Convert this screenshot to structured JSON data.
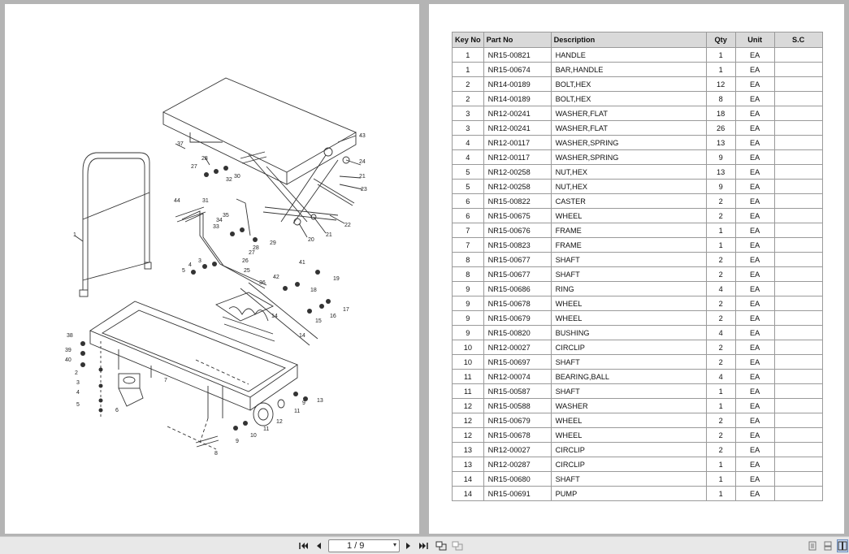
{
  "table": {
    "headers": {
      "key": "Key No",
      "part": "Part No",
      "desc": "Description",
      "qty": "Qty",
      "unit": "Unit",
      "sc": "S.C"
    },
    "rows": [
      {
        "key": "1",
        "part": "NR15-00821",
        "desc": "HANDLE",
        "qty": "1",
        "unit": "EA",
        "sc": ""
      },
      {
        "key": "1",
        "part": "NR15-00674",
        "desc": "BAR,HANDLE",
        "qty": "1",
        "unit": "EA",
        "sc": ""
      },
      {
        "key": "2",
        "part": "NR14-00189",
        "desc": "BOLT,HEX",
        "qty": "12",
        "unit": "EA",
        "sc": ""
      },
      {
        "key": "2",
        "part": "NR14-00189",
        "desc": "BOLT,HEX",
        "qty": "8",
        "unit": "EA",
        "sc": ""
      },
      {
        "key": "3",
        "part": "NR12-00241",
        "desc": "WASHER,FLAT",
        "qty": "18",
        "unit": "EA",
        "sc": ""
      },
      {
        "key": "3",
        "part": "NR12-00241",
        "desc": "WASHER,FLAT",
        "qty": "26",
        "unit": "EA",
        "sc": ""
      },
      {
        "key": "4",
        "part": "NR12-00117",
        "desc": "WASHER,SPRING",
        "qty": "13",
        "unit": "EA",
        "sc": ""
      },
      {
        "key": "4",
        "part": "NR12-00117",
        "desc": "WASHER,SPRING",
        "qty": "9",
        "unit": "EA",
        "sc": ""
      },
      {
        "key": "5",
        "part": "NR12-00258",
        "desc": "NUT,HEX",
        "qty": "13",
        "unit": "EA",
        "sc": ""
      },
      {
        "key": "5",
        "part": "NR12-00258",
        "desc": "NUT,HEX",
        "qty": "9",
        "unit": "EA",
        "sc": ""
      },
      {
        "key": "6",
        "part": "NR15-00822",
        "desc": "CASTER",
        "qty": "2",
        "unit": "EA",
        "sc": ""
      },
      {
        "key": "6",
        "part": "NR15-00675",
        "desc": "WHEEL",
        "qty": "2",
        "unit": "EA",
        "sc": ""
      },
      {
        "key": "7",
        "part": "NR15-00676",
        "desc": "FRAME",
        "qty": "1",
        "unit": "EA",
        "sc": ""
      },
      {
        "key": "7",
        "part": "NR15-00823",
        "desc": "FRAME",
        "qty": "1",
        "unit": "EA",
        "sc": ""
      },
      {
        "key": "8",
        "part": "NR15-00677",
        "desc": "SHAFT",
        "qty": "2",
        "unit": "EA",
        "sc": ""
      },
      {
        "key": "8",
        "part": "NR15-00677",
        "desc": "SHAFT",
        "qty": "2",
        "unit": "EA",
        "sc": ""
      },
      {
        "key": "9",
        "part": "NR15-00686",
        "desc": "RING",
        "qty": "4",
        "unit": "EA",
        "sc": ""
      },
      {
        "key": "9",
        "part": "NR15-00678",
        "desc": "WHEEL",
        "qty": "2",
        "unit": "EA",
        "sc": ""
      },
      {
        "key": "9",
        "part": "NR15-00679",
        "desc": "WHEEL",
        "qty": "2",
        "unit": "EA",
        "sc": ""
      },
      {
        "key": "9",
        "part": "NR15-00820",
        "desc": "BUSHING",
        "qty": "4",
        "unit": "EA",
        "sc": ""
      },
      {
        "key": "10",
        "part": "NR12-00027",
        "desc": "CIRCLIP",
        "qty": "2",
        "unit": "EA",
        "sc": ""
      },
      {
        "key": "10",
        "part": "NR15-00697",
        "desc": "SHAFT",
        "qty": "2",
        "unit": "EA",
        "sc": ""
      },
      {
        "key": "11",
        "part": "NR12-00074",
        "desc": "BEARING,BALL",
        "qty": "4",
        "unit": "EA",
        "sc": ""
      },
      {
        "key": "11",
        "part": "NR15-00587",
        "desc": "SHAFT",
        "qty": "1",
        "unit": "EA",
        "sc": ""
      },
      {
        "key": "12",
        "part": "NR15-00588",
        "desc": "WASHER",
        "qty": "1",
        "unit": "EA",
        "sc": ""
      },
      {
        "key": "12",
        "part": "NR15-00679",
        "desc": "WHEEL",
        "qty": "2",
        "unit": "EA",
        "sc": ""
      },
      {
        "key": "12",
        "part": "NR15-00678",
        "desc": "WHEEL",
        "qty": "2",
        "unit": "EA",
        "sc": ""
      },
      {
        "key": "13",
        "part": "NR12-00027",
        "desc": "CIRCLIP",
        "qty": "2",
        "unit": "EA",
        "sc": ""
      },
      {
        "key": "13",
        "part": "NR12-00287",
        "desc": "CIRCLIP",
        "qty": "1",
        "unit": "EA",
        "sc": ""
      },
      {
        "key": "14",
        "part": "NR15-00680",
        "desc": "SHAFT",
        "qty": "1",
        "unit": "EA",
        "sc": ""
      },
      {
        "key": "14",
        "part": "NR15-00691",
        "desc": "PUMP",
        "qty": "1",
        "unit": "EA",
        "sc": ""
      }
    ]
  },
  "diagram": {
    "callouts": [
      "43",
      "24",
      "21",
      "23",
      "22",
      "21",
      "20",
      "37",
      "28",
      "27",
      "32",
      "30",
      "44",
      "31",
      "35",
      "33",
      "34",
      "28",
      "29",
      "27",
      "26",
      "25",
      "3",
      "4",
      "5",
      "36",
      "42",
      "41",
      "19",
      "18",
      "14",
      "17",
      "16",
      "15",
      "14",
      "1",
      "38",
      "39",
      "40",
      "2",
      "3",
      "4",
      "5",
      "6",
      "7",
      "8",
      "9",
      "10",
      "11",
      "12",
      "13",
      "11",
      "9"
    ]
  },
  "toolbar": {
    "page_indicator": "1 / 9",
    "first_icon": "first-page-icon",
    "prev_icon": "prev-page-icon",
    "next_icon": "next-page-icon",
    "last_icon": "last-page-icon"
  }
}
